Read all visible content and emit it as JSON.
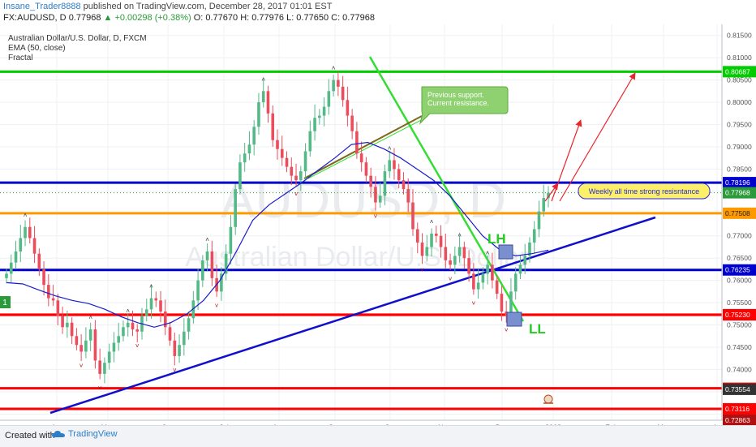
{
  "header": {
    "author": "Insane_Trader8888",
    "published_text": "published on TradingView.com, December 28, 2017 01:01 EST",
    "symbol_line": "FX:AUDUSD, D",
    "last": "0.77968",
    "change": "▲ +0.00298 (+0.38%)",
    "ohlc": "O: 0.77670  H: 0.77976  L: 0.77650  C: 0.77968"
  },
  "legend": {
    "title": "Australian Dollar/U.S. Dollar, D, FXCM",
    "ema": "EMA (50, close)",
    "fractal": "Fractal"
  },
  "watermark": {
    "symbol": "AUDUSD, D",
    "name": "Australian Dollar/U.S. Dollar"
  },
  "annotations": {
    "callout_green": "Previous support.\nCurrent resistance.",
    "callout_yellow": "Weekly all time strong resisntance",
    "lh": "LH",
    "ll": "LL",
    "left_marker": "1"
  },
  "footer": {
    "created_with": "Created with",
    "brand": "TradingView"
  },
  "chart_data": {
    "type": "candlestick",
    "title": "Australian Dollar/U.S. Dollar, D, FXCM",
    "x_ticks": [
      "Apr",
      "May",
      "Jun",
      "Jul",
      "Aug",
      "Sep",
      "Oct",
      "Nov",
      "Dec",
      "2018",
      "Feb",
      "Mar",
      "Ap"
    ],
    "y_ticks": [
      0.815,
      0.81,
      0.805,
      0.8,
      0.795,
      0.79,
      0.785,
      0.78,
      0.775,
      0.77,
      0.765,
      0.76,
      0.755,
      0.75,
      0.745,
      0.74,
      0.735,
      0.73
    ],
    "ylim": [
      0.7286,
      0.8175
    ],
    "horizontal_levels": [
      {
        "value": 0.80687,
        "label": "0.80687",
        "color": "#00cc00"
      },
      {
        "value": 0.78196,
        "label": "0.78196",
        "color": "#0000cc"
      },
      {
        "value": 0.77508,
        "label": "0.77508",
        "color": "#ff9900"
      },
      {
        "value": 0.76235,
        "label": "0.76235",
        "color": "#0000cc"
      },
      {
        "value": 0.75226,
        "label": "0.75226",
        "color": "#ff0000"
      },
      {
        "value": 0.7523,
        "label": "0.75230",
        "color": "#ff0000"
      },
      {
        "value": 0.73578,
        "label": "0.73578",
        "color": "#ff0000"
      },
      {
        "value": 0.73116,
        "label": "0.73116",
        "color": "#ff0000"
      }
    ],
    "price_labels": [
      {
        "value": 0.77968,
        "label": "0.77968",
        "color": "#2a9a3a"
      },
      {
        "value": 0.73554,
        "label": "0.73554",
        "color": "#333333"
      },
      {
        "value": 0.72863,
        "label": "0.72863",
        "color": "#b01010"
      }
    ],
    "last_price": 0.77968,
    "ema50": [
      0.7595,
      0.7592,
      0.7578,
      0.7565,
      0.7555,
      0.7548,
      0.7535,
      0.7518,
      0.7505,
      0.7495,
      0.7505,
      0.7525,
      0.7555,
      0.76,
      0.7665,
      0.7735,
      0.777,
      0.7795,
      0.782,
      0.7848,
      0.7875,
      0.7905,
      0.791,
      0.7895,
      0.7875,
      0.785,
      0.7825,
      0.779,
      0.7745,
      0.77,
      0.767,
      0.7655,
      0.766,
      0.7668
    ],
    "candles_close": [
      0.7615,
      0.764,
      0.7665,
      0.7695,
      0.772,
      0.7695,
      0.766,
      0.7625,
      0.759,
      0.756,
      0.7555,
      0.752,
      0.7495,
      0.7505,
      0.7475,
      0.7455,
      0.744,
      0.7465,
      0.749,
      0.742,
      0.739,
      0.7415,
      0.744,
      0.746,
      0.7475,
      0.7495,
      0.7505,
      0.749,
      0.7485,
      0.752,
      0.7535,
      0.756,
      0.7555,
      0.753,
      0.7495,
      0.7465,
      0.743,
      0.7455,
      0.7485,
      0.7515,
      0.7555,
      0.76,
      0.7645,
      0.7665,
      0.7605,
      0.7575,
      0.7615,
      0.766,
      0.772,
      0.7805,
      0.7865,
      0.7885,
      0.7905,
      0.7945,
      0.8,
      0.8025,
      0.7975,
      0.7915,
      0.7895,
      0.7875,
      0.7855,
      0.7835,
      0.7825,
      0.7845,
      0.789,
      0.7935,
      0.7965,
      0.797,
      0.799,
      0.8025,
      0.805,
      0.8035,
      0.8005,
      0.797,
      0.7935,
      0.7885,
      0.7865,
      0.7835,
      0.781,
      0.7775,
      0.779,
      0.7845,
      0.787,
      0.785,
      0.7825,
      0.7805,
      0.7775,
      0.7715,
      0.7685,
      0.7655,
      0.7675,
      0.7705,
      0.77,
      0.7675,
      0.7645,
      0.7635,
      0.7655,
      0.7675,
      0.765,
      0.7615,
      0.758,
      0.7595,
      0.7615,
      0.7635,
      0.76,
      0.757,
      0.753,
      0.752,
      0.7575,
      0.7615,
      0.7635,
      0.7655,
      0.7685,
      0.7715,
      0.7755,
      0.7785,
      0.77968
    ]
  }
}
